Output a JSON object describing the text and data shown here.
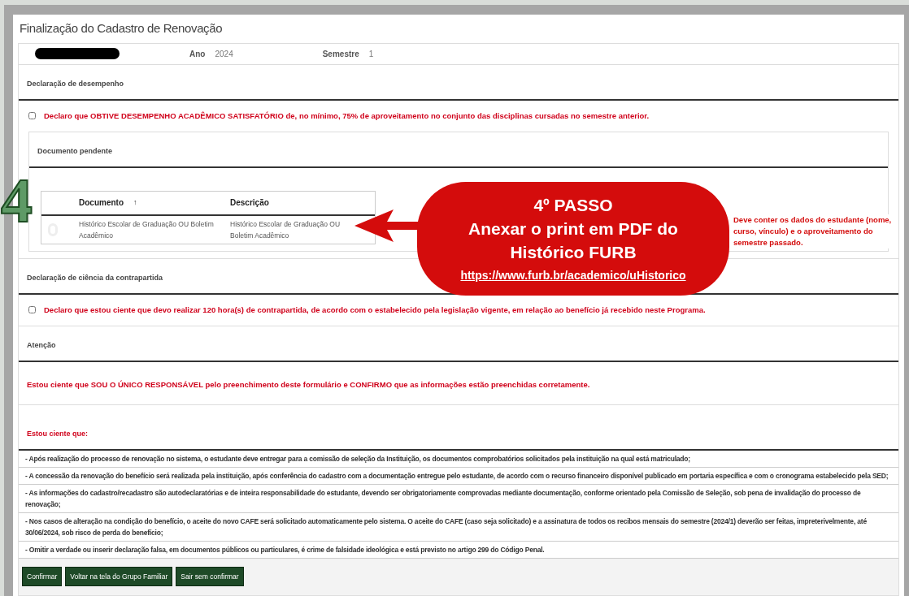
{
  "page_title": "Finalização do Cadastro de Renovação",
  "header": {
    "name_redacted": true,
    "fields": [
      {
        "label": "Ano",
        "value": "2024"
      },
      {
        "label": "Semestre",
        "value": "1"
      }
    ]
  },
  "performance": {
    "title": "Declaração de desempenho",
    "checked": false,
    "text": "Declaro que OBTIVE DESEMPENHO ACADÊMICO SATISFATÓRIO de, no mínimo, 75% de aproveitamento no conjunto das disciplinas cursadas no semestre anterior."
  },
  "pending_document": {
    "title": "Documento pendente",
    "columns": [
      {
        "label": "Documento",
        "sort_indicator": "↑"
      },
      {
        "label": "Descrição"
      }
    ],
    "rows": [
      {
        "cells": [
          "Histórico Escolar de Graduação OU Boletim Acadêmico",
          "Histórico Escolar de Graduação OU Boletim Acadêmico"
        ]
      }
    ]
  },
  "counterpart": {
    "title": "Declaração de ciência da contrapartida",
    "checked": false,
    "text": "Declaro que estou ciente que devo realizar 120 hora(s) de contrapartida, de acordo com o estabelecido pela legislação vigente, em relação ao benefício já recebido neste Programa."
  },
  "attention": {
    "title": "Atenção",
    "text": "Estou ciente que SOU O ÚNICO RESPONSÁVEL pelo preenchimento deste formulário e CONFIRMO que as informações estão preenchidas corretamente."
  },
  "awareness": {
    "title": "Estou ciente que:",
    "items": [
      "- Após realização do processo de renovação no sistema, o estudante deve entregar para a comissão de seleção da Instituição, os documentos comprobatórios solicitados pela instituição na qual está matriculado;",
      "- A concessão da renovação do benefício será realizada pela instituição, após conferência do cadastro com a documentação entregue pelo estudante, de acordo com o recurso financeiro disponível publicado em portaria específica e com o cronograma estabelecido pela SED;",
      "- As informações do cadastro/recadastro são autodeclaratórias e de inteira responsabilidade do estudante, devendo ser obrigatoriamente comprovadas mediante documentação, conforme orientado pela Comissão de Seleção, sob pena de invalidação do processo de renovação;",
      "- Nos casos de alteração na condição do benefício, o aceite do novo CAFE será solicitado automaticamente pelo sistema. O aceite do CAFE (caso seja solicitado) e a assinatura de todos os recibos mensais do semestre (2024/1) deverão ser feitas, impreterivelmente, até 30/06/2024, sob risco de perda do benefício;",
      "- Omitir a verdade ou inserir declaração falsa, em documentos públicos ou particulares, é crime de falsidade ideológica e está previsto no artigo 299 do Código Penal."
    ]
  },
  "buttons": [
    "Confirmar",
    "Voltar na tela do Grupo Familiar",
    "Sair sem confirmar"
  ],
  "annotation": {
    "step_number": "4",
    "title": "4º PASSO",
    "lines": [
      "Anexar o print em PDF do",
      "Histórico FURB"
    ],
    "link": "https://www.furb.br/academico/uHistorico",
    "note": "Deve conter os dados do estudante (nome, curso, vínculo) e o aproveitamento do semestre passado."
  }
}
